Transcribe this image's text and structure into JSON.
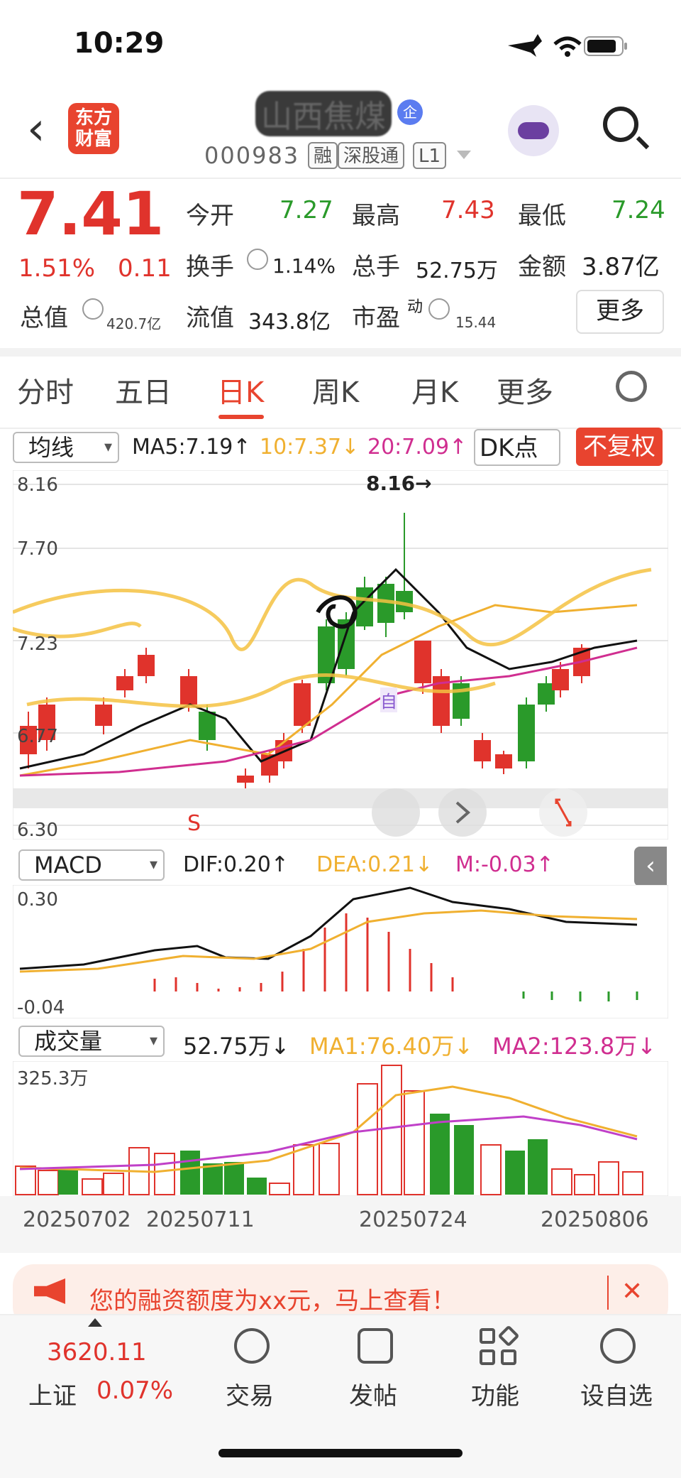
{
  "status": {
    "time": "10:29"
  },
  "header": {
    "app_logo": "东方\n财富",
    "stock_name": "山西焦煤",
    "badge": "企",
    "code": "000983",
    "tags": [
      "融",
      "深股通",
      "L1"
    ]
  },
  "quote": {
    "price": "7.41",
    "change_pct": "1.51%",
    "change": "0.11",
    "open_label": "今开",
    "open": "7.27",
    "high_label": "最高",
    "high": "7.43",
    "low_label": "最低",
    "low": "7.24",
    "turnover_label": "换手",
    "turnover": "1.14%",
    "vol_label": "总手",
    "vol": "52.75万",
    "amount_label": "金额",
    "amount": "3.87亿",
    "mktcap_label": "总值",
    "mktcap": "420.7亿",
    "float_label": "流值",
    "float": "343.8亿",
    "pe_label": "市盈",
    "pe_sup": "动",
    "pe": "15.44",
    "more": "更多"
  },
  "tabs": [
    "分时",
    "五日",
    "日K",
    "周K",
    "月K",
    "更多"
  ],
  "active_tab": "日K",
  "kline": {
    "indicator": "均线",
    "ma5": "MA5:7.19↑",
    "ma10": "10:7.37↓",
    "ma20": "20:7.09↑",
    "dk": "DK点",
    "fq": "不复权",
    "axis": [
      "8.16",
      "7.70",
      "7.23",
      "6.77",
      "6.30"
    ],
    "high_mark": "8.16→",
    "self_mark": "自",
    "s_mark": "S"
  },
  "macd": {
    "indicator": "MACD",
    "dif": "DIF:0.20↑",
    "dea": "DEA:0.21↓",
    "m": "M:-0.03↑",
    "axis": [
      "0.30",
      "-0.04"
    ]
  },
  "volume": {
    "indicator": "成交量",
    "value": "52.75万↓",
    "ma1": "MA1:76.40万↓",
    "ma2": "MA2:123.8万↓",
    "axis_top": "325.3万"
  },
  "dates": [
    "20250702",
    "20250711",
    "20250724",
    "20250806"
  ],
  "banner": {
    "text": "您的融资额度为xx元，马上查看！"
  },
  "bottom": {
    "index_value": "3620.11",
    "index_name": "上证",
    "index_pct": "0.07%",
    "items": [
      "交易",
      "发帖",
      "功能",
      "设自选"
    ]
  },
  "colors": {
    "up": "#e0332c",
    "down": "#2a9a2a",
    "accent": "#e8442f",
    "ma10": "#f0b030",
    "ma20": "#d02e90"
  }
}
